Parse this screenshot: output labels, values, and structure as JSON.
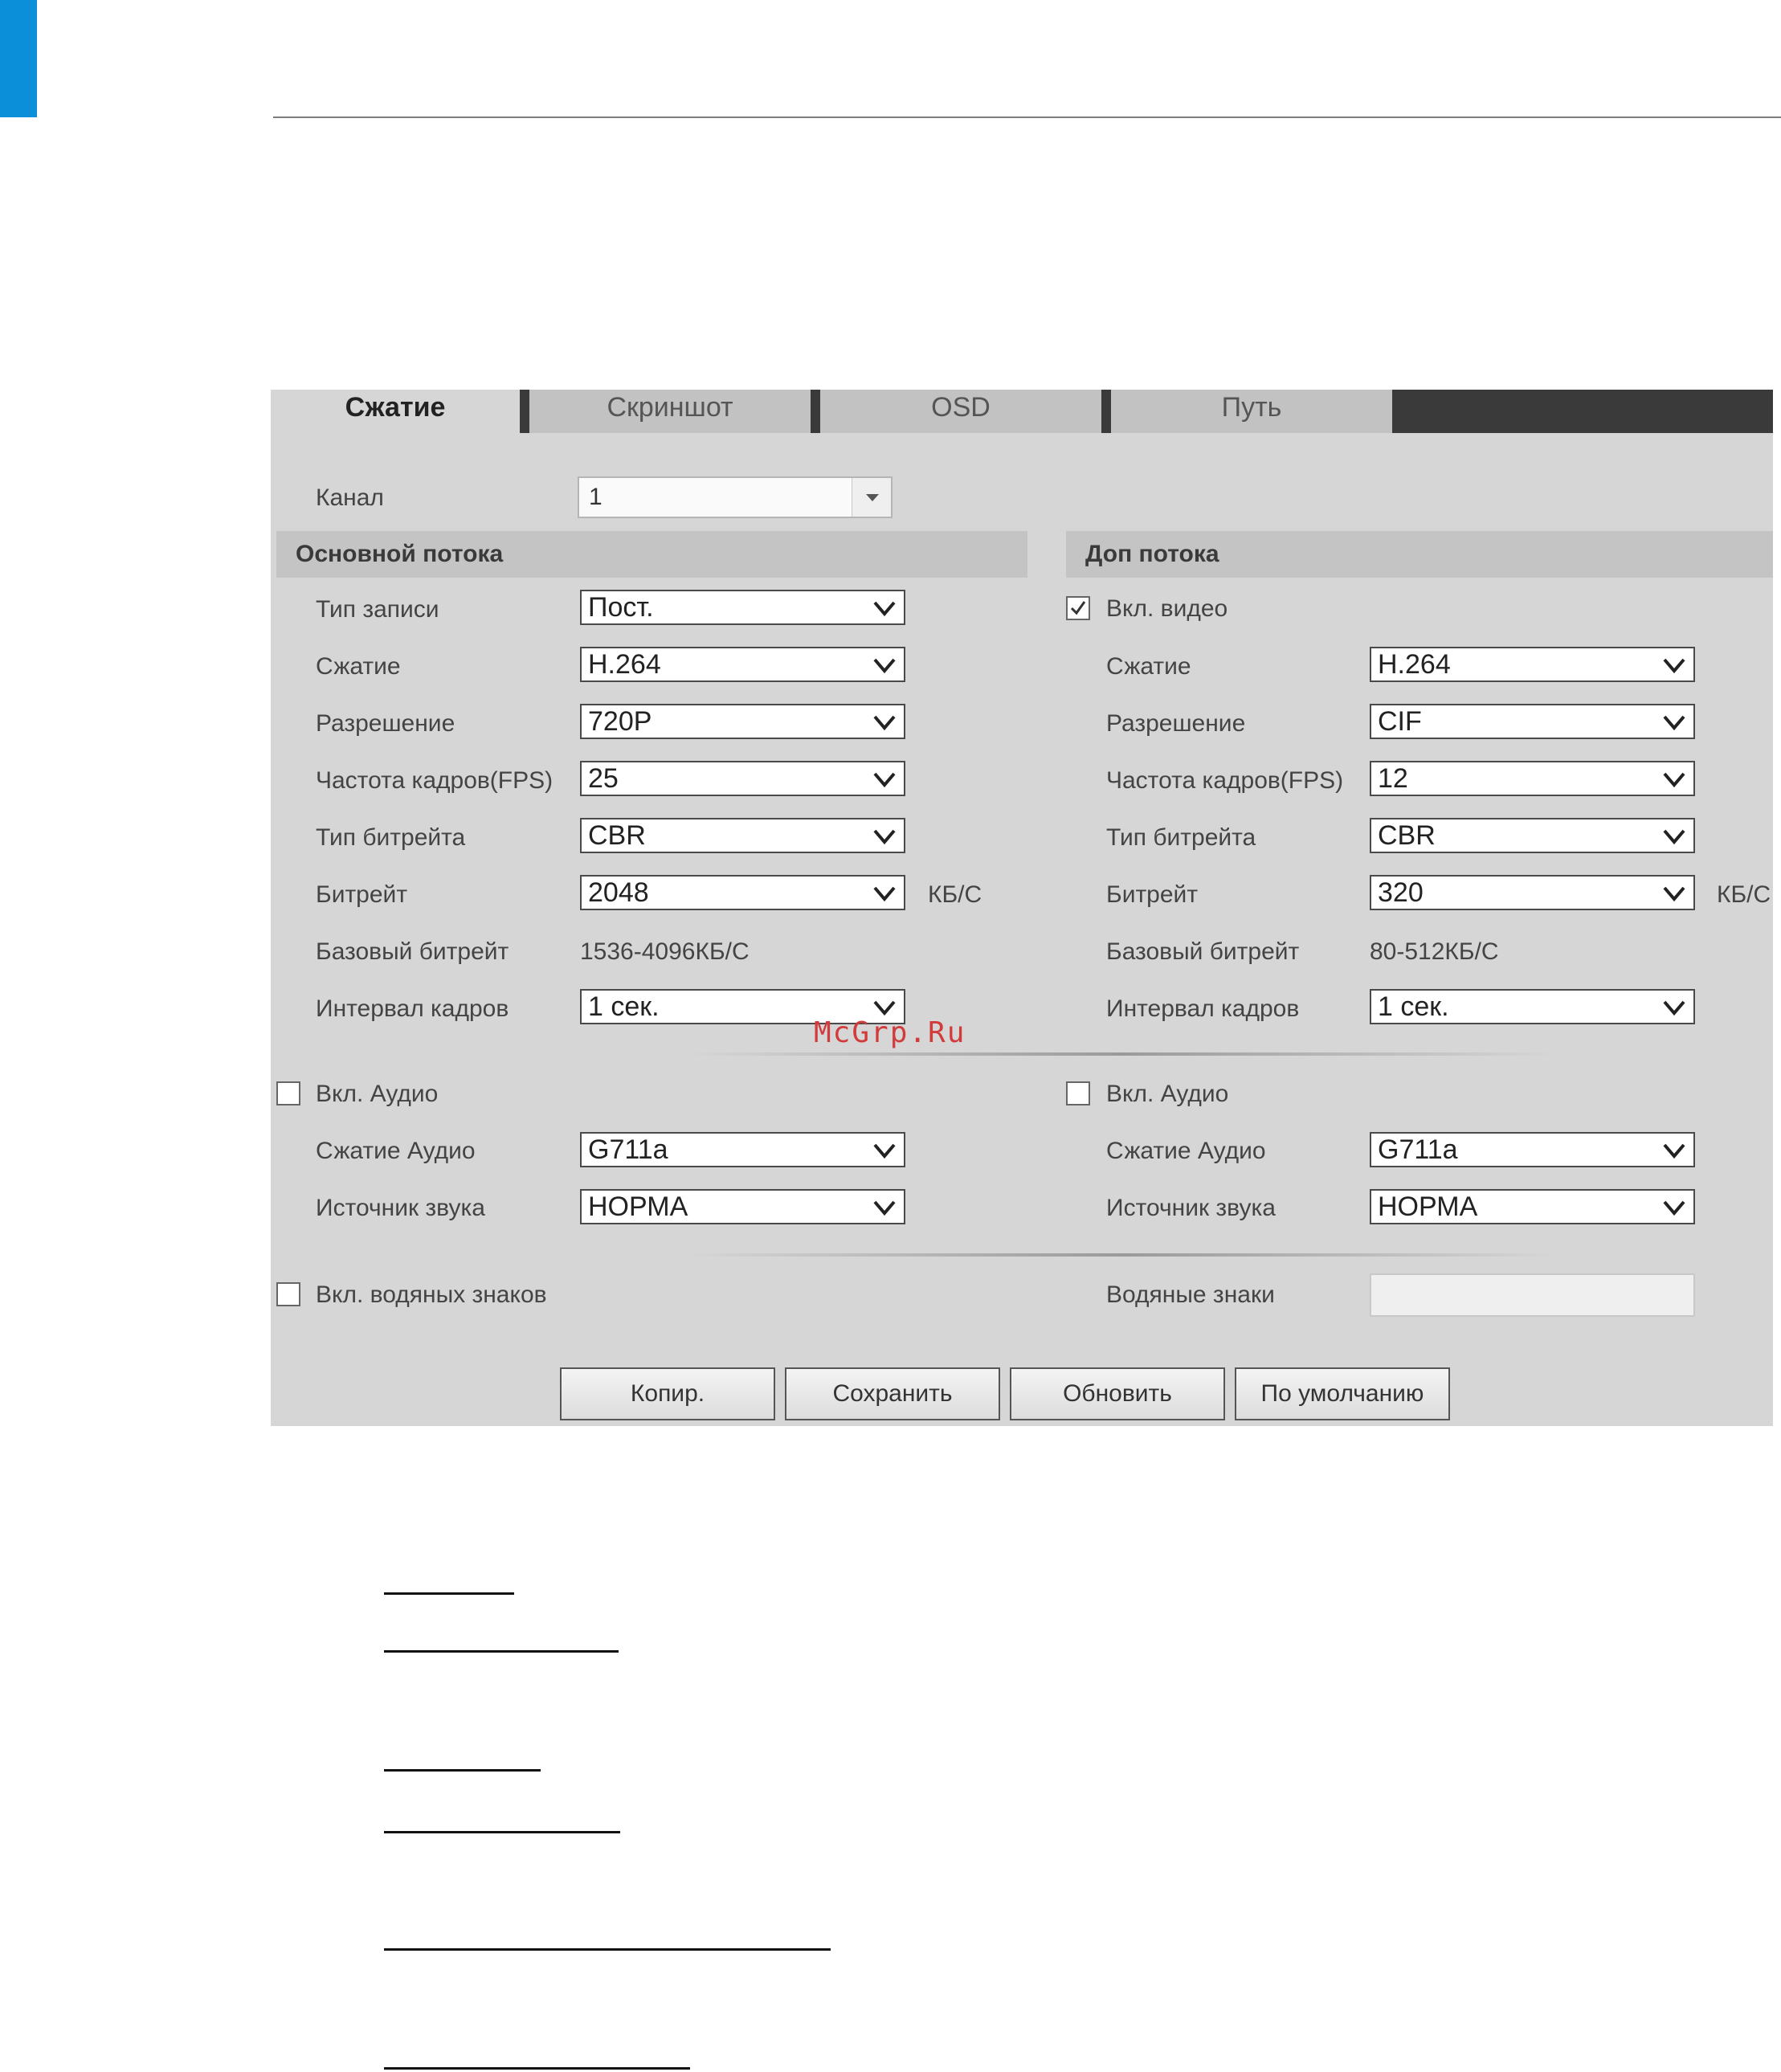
{
  "tabs": [
    "Сжатие",
    "Скриншот",
    "OSD",
    "Путь"
  ],
  "channel": {
    "label": "Канал",
    "value": "1"
  },
  "main_stream": {
    "title": "Основной потока",
    "rows": [
      {
        "label": "Тип записи",
        "value": "Пост."
      },
      {
        "label": "Сжатие",
        "value": "H.264"
      },
      {
        "label": "Разрешение",
        "value": "720P"
      },
      {
        "label": "Частота кадров(FPS)",
        "value": "25"
      },
      {
        "label": "Тип битрейта",
        "value": "CBR"
      },
      {
        "label": "Битрейт",
        "value": "2048",
        "unit": "КБ/С"
      },
      {
        "label": "Базовый битрейт",
        "static": "1536-4096КБ/С"
      },
      {
        "label": "Интервал кадров",
        "value": "1 сек."
      }
    ],
    "audio": {
      "enable_label": "Вкл. Аудио",
      "checked": false,
      "compression_label": "Сжатие Аудио",
      "compression": "G711a",
      "source_label": "Источник звука",
      "source": "НОРМА"
    },
    "watermark_enable": {
      "label": "Вкл. водяных знаков",
      "checked": false
    }
  },
  "sub_stream": {
    "title": "Доп потока",
    "video_enable": {
      "label": "Вкл. видео",
      "checked": true
    },
    "rows": [
      {
        "label": "Сжатие",
        "value": "H.264"
      },
      {
        "label": "Разрешение",
        "value": "CIF"
      },
      {
        "label": "Частота кадров(FPS)",
        "value": "12"
      },
      {
        "label": "Тип битрейта",
        "value": "CBR"
      },
      {
        "label": "Битрейт",
        "value": "320",
        "unit": "КБ/С"
      },
      {
        "label": "Базовый битрейт",
        "static": "80-512КБ/С"
      },
      {
        "label": "Интервал кадров",
        "value": "1 сек."
      }
    ],
    "audio": {
      "enable_label": "Вкл. Аудио",
      "checked": false,
      "compression_label": "Сжатие Аудио",
      "compression": "G711a",
      "source_label": "Источник звука",
      "source": "НОРМА"
    },
    "watermark": {
      "label": "Водяные знаки",
      "value": ""
    }
  },
  "buttons": [
    "Копир.",
    "Сохранить",
    "Обновить",
    "По умолчанию"
  ],
  "overlay_watermark": "McGrp.Ru",
  "colors": {
    "accent_blue": "#0a8fd8",
    "panel_bg": "#d6d6d6",
    "tab_dark": "#3a3a3a"
  }
}
